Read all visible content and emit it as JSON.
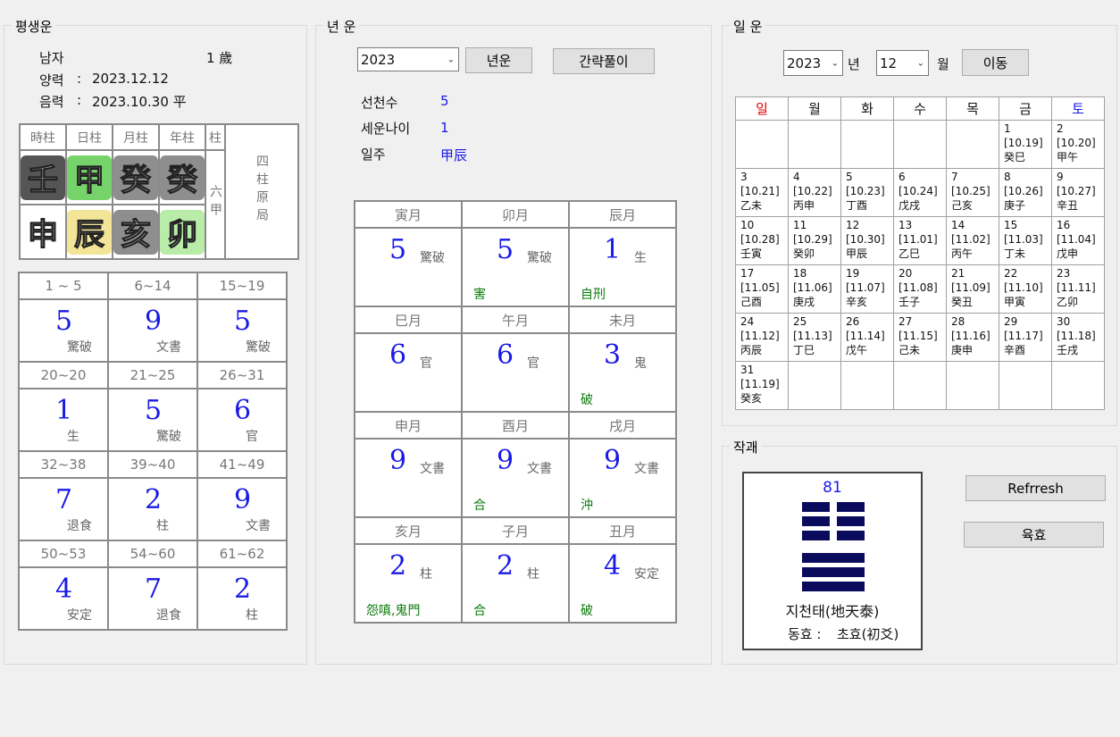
{
  "lifetime": {
    "title": "평생운",
    "gender": "남자",
    "age": "1 歲",
    "solar_label": "양력",
    "solar_date": "2023.12.12",
    "lunar_label": "음력",
    "lunar_date": "2023.10.30 平",
    "colon": ":",
    "pillar_headers": [
      "時柱",
      "日柱",
      "月柱",
      "年柱",
      "柱"
    ],
    "stems": [
      "壬",
      "甲",
      "癸",
      "癸"
    ],
    "branches": [
      "申",
      "辰",
      "亥",
      "卯"
    ],
    "six_label": "六甲",
    "four_label": "四柱原局",
    "periods": [
      [
        {
          "range": "1 ~ 5",
          "num": "5",
          "sub": "驚破"
        },
        {
          "range": "6~14",
          "num": "9",
          "sub": "文書"
        },
        {
          "range": "15~19",
          "num": "5",
          "sub": "驚破"
        }
      ],
      [
        {
          "range": "20~20",
          "num": "1",
          "sub": "生"
        },
        {
          "range": "21~25",
          "num": "5",
          "sub": "驚破"
        },
        {
          "range": "26~31",
          "num": "6",
          "sub": "官"
        }
      ],
      [
        {
          "range": "32~38",
          "num": "7",
          "sub": "退食"
        },
        {
          "range": "39~40",
          "num": "2",
          "sub": "柱"
        },
        {
          "range": "41~49",
          "num": "9",
          "sub": "文書"
        }
      ],
      [
        {
          "range": "50~53",
          "num": "4",
          "sub": "安定"
        },
        {
          "range": "54~60",
          "num": "7",
          "sub": "退食"
        },
        {
          "range": "61~62",
          "num": "2",
          "sub": "柱"
        }
      ]
    ]
  },
  "yearly": {
    "title": "년 운",
    "year_value": "2023",
    "btn_year": "년운",
    "btn_brief": "간략풀이",
    "info": [
      {
        "label": "선천수",
        "value": "5"
      },
      {
        "label": "세운나이",
        "value": "1"
      },
      {
        "label": "일주",
        "value": "甲辰"
      }
    ],
    "months": [
      [
        {
          "name": "寅月",
          "num": "5",
          "sub": "驚破",
          "note": ""
        },
        {
          "name": "卯月",
          "num": "5",
          "sub": "驚破",
          "note": "害"
        },
        {
          "name": "辰月",
          "num": "1",
          "sub": "生",
          "note": "自刑"
        }
      ],
      [
        {
          "name": "巳月",
          "num": "6",
          "sub": "官",
          "note": ""
        },
        {
          "name": "午月",
          "num": "6",
          "sub": "官",
          "note": ""
        },
        {
          "name": "未月",
          "num": "3",
          "sub": "鬼",
          "note": "破"
        }
      ],
      [
        {
          "name": "申月",
          "num": "9",
          "sub": "文書",
          "note": ""
        },
        {
          "name": "酉月",
          "num": "9",
          "sub": "文書",
          "note": "合"
        },
        {
          "name": "戌月",
          "num": "9",
          "sub": "文書",
          "note": "沖"
        }
      ],
      [
        {
          "name": "亥月",
          "num": "2",
          "sub": "柱",
          "note": "怨嗔,鬼門"
        },
        {
          "name": "子月",
          "num": "2",
          "sub": "柱",
          "note": "合"
        },
        {
          "name": "丑月",
          "num": "4",
          "sub": "安定",
          "note": "破"
        }
      ]
    ]
  },
  "daily": {
    "title": "일 운",
    "year_value": "2023",
    "year_label": "년",
    "month_value": "12",
    "month_label": "월",
    "btn_move": "이동",
    "weekdays": [
      "일",
      "월",
      "화",
      "수",
      "목",
      "금",
      "토"
    ],
    "weeks": [
      [
        null,
        null,
        null,
        null,
        null,
        {
          "d": "1",
          "l": "[10.19]",
          "g": "癸巳"
        },
        {
          "d": "2",
          "l": "[10.20]",
          "g": "甲午"
        }
      ],
      [
        {
          "d": "3",
          "l": "[10.21]",
          "g": "乙未"
        },
        {
          "d": "4",
          "l": "[10.22]",
          "g": "丙申"
        },
        {
          "d": "5",
          "l": "[10.23]",
          "g": "丁酉"
        },
        {
          "d": "6",
          "l": "[10.24]",
          "g": "戊戌"
        },
        {
          "d": "7",
          "l": "[10.25]",
          "g": "己亥"
        },
        {
          "d": "8",
          "l": "[10.26]",
          "g": "庚子"
        },
        {
          "d": "9",
          "l": "[10.27]",
          "g": "辛丑"
        }
      ],
      [
        {
          "d": "10",
          "l": "[10.28]",
          "g": "壬寅"
        },
        {
          "d": "11",
          "l": "[10.29]",
          "g": "癸卯"
        },
        {
          "d": "12",
          "l": "[10.30]",
          "g": "甲辰"
        },
        {
          "d": "13",
          "l": "[11.01]",
          "g": "乙巳"
        },
        {
          "d": "14",
          "l": "[11.02]",
          "g": "丙午"
        },
        {
          "d": "15",
          "l": "[11.03]",
          "g": "丁未"
        },
        {
          "d": "16",
          "l": "[11.04]",
          "g": "戊申"
        }
      ],
      [
        {
          "d": "17",
          "l": "[11.05]",
          "g": "己酉"
        },
        {
          "d": "18",
          "l": "[11.06]",
          "g": "庚戌"
        },
        {
          "d": "19",
          "l": "[11.07]",
          "g": "辛亥"
        },
        {
          "d": "20",
          "l": "[11.08]",
          "g": "壬子"
        },
        {
          "d": "21",
          "l": "[11.09]",
          "g": "癸丑"
        },
        {
          "d": "22",
          "l": "[11.10]",
          "g": "甲寅"
        },
        {
          "d": "23",
          "l": "[11.11]",
          "g": "乙卯"
        }
      ],
      [
        {
          "d": "24",
          "l": "[11.12]",
          "g": "丙辰"
        },
        {
          "d": "25",
          "l": "[11.13]",
          "g": "丁巳"
        },
        {
          "d": "26",
          "l": "[11.14]",
          "g": "戊午"
        },
        {
          "d": "27",
          "l": "[11.15]",
          "g": "己未"
        },
        {
          "d": "28",
          "l": "[11.16]",
          "g": "庚申"
        },
        {
          "d": "29",
          "l": "[11.17]",
          "g": "辛酉"
        },
        {
          "d": "30",
          "l": "[11.18]",
          "g": "壬戌"
        }
      ],
      [
        {
          "d": "31",
          "l": "[11.19]",
          "g": "癸亥"
        },
        null,
        null,
        null,
        null,
        null,
        null
      ]
    ]
  },
  "hexagram": {
    "title": "작괘",
    "number": "81",
    "name": "지천태(地天泰)",
    "moving_label": "동효 :",
    "moving_value": "초효(初爻)",
    "lines": [
      "broken",
      "broken",
      "broken",
      "solid",
      "solid",
      "solid"
    ],
    "btn_refresh": "Refrresh",
    "btn_yukhyo": "육효"
  },
  "colors": {
    "accent_blue": "#1a1ae6",
    "note_green": "#0a7a0a",
    "sunday_red": "#e00000",
    "saturday_blue": "#1a1ae6",
    "hexagram_navy": "#0b0b5e"
  }
}
